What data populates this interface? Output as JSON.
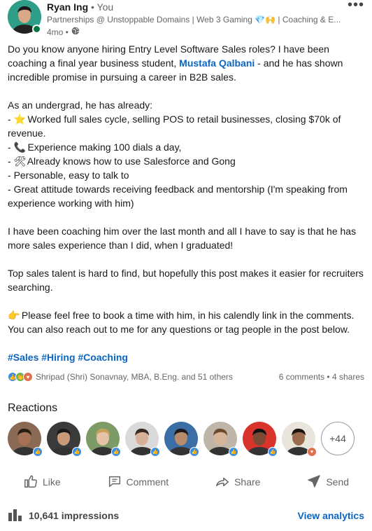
{
  "author": {
    "name": "Ryan Ing",
    "relation": "• You",
    "headline": "Partnerships @ Unstoppable Domains | Web 3 Gaming 💎🙌 | Coaching & E...",
    "time": "4mo •"
  },
  "post": {
    "intro_before": "Do you know anyone hiring Entry Level Software Sales roles? I have been coaching a final year business student, ",
    "mention": "Mustafa Qalbani",
    "intro_after": " - and he has shown incredible promise in pursuing a career in B2B sales.",
    "list_heading": "As an undergrad, he has already:",
    "bullets": [
      {
        "emoji": "⭐",
        "text": "Worked full sales cycle, selling POS to retail businesses, closing $70k of revenue."
      },
      {
        "emoji": "📞",
        "text": "Experience making 100 dials a day,"
      },
      {
        "emoji": "🛠",
        "text": "Already knows how to use Salesforce and Gong"
      },
      {
        "emoji": "",
        "text": "Personable, easy to talk to"
      },
      {
        "emoji": "",
        "text": "Great attitude towards receiving feedback and mentorship (I'm speaking from experience working with him)"
      }
    ],
    "paragraph2": "I have been coaching him over the last month and all I have to say is that he has more sales experience than I did, when I graduated!",
    "paragraph3": "Top sales talent is hard to find, but hopefully this post makes it easier for recruiters searching.",
    "cta_emoji": "👉",
    "paragraph4": "Please feel free to book a time with him, in his calendly link in the comments. You can also reach out to me for any questions or tag people in the post below.",
    "hashtags": "#Sales #Hiring #Coaching"
  },
  "social": {
    "reactors_text": "Shripad (Shri) Sonavnay, MBA, B.Eng. and 51 others",
    "comments": "6 comments",
    "separator": " • ",
    "shares": "4 shares"
  },
  "reactions": {
    "title": "Reactions",
    "more": "+44",
    "people": [
      {
        "bg": "#8a6a55",
        "skin": "#a57256",
        "hair": "#2a1d14",
        "badge": "like"
      },
      {
        "bg": "#3b3b3b",
        "skin": "#c89a7a",
        "hair": "#1a1a1a",
        "badge": "like"
      },
      {
        "bg": "#7d9b67",
        "skin": "#e6c2a6",
        "hair": "#c9a35a",
        "badge": "like"
      },
      {
        "bg": "#dadada",
        "skin": "#d7b098",
        "hair": "#3a2a22",
        "badge": "like"
      },
      {
        "bg": "#3a6ea5",
        "skin": "#b88b6a",
        "hair": "#1c1c1c",
        "badge": "like"
      },
      {
        "bg": "#bfb5a8",
        "skin": "#d7b59a",
        "hair": "#6b4a30",
        "badge": "like"
      },
      {
        "bg": "#d8342c",
        "skin": "#7a4a35",
        "hair": "#111111",
        "badge": "like"
      },
      {
        "bg": "#e9e4dc",
        "skin": "#9c6b4d",
        "hair": "#1c1410",
        "badge": "love"
      }
    ]
  },
  "actions": {
    "like": "Like",
    "comment": "Comment",
    "share": "Share",
    "send": "Send"
  },
  "footer": {
    "impressions": "10,641 impressions",
    "analytics": "View analytics"
  },
  "colors": {
    "link": "#0a66c2",
    "like": "#378fe9",
    "love": "#df704d",
    "celebrate": "#6dae4f",
    "online": "#057642"
  }
}
